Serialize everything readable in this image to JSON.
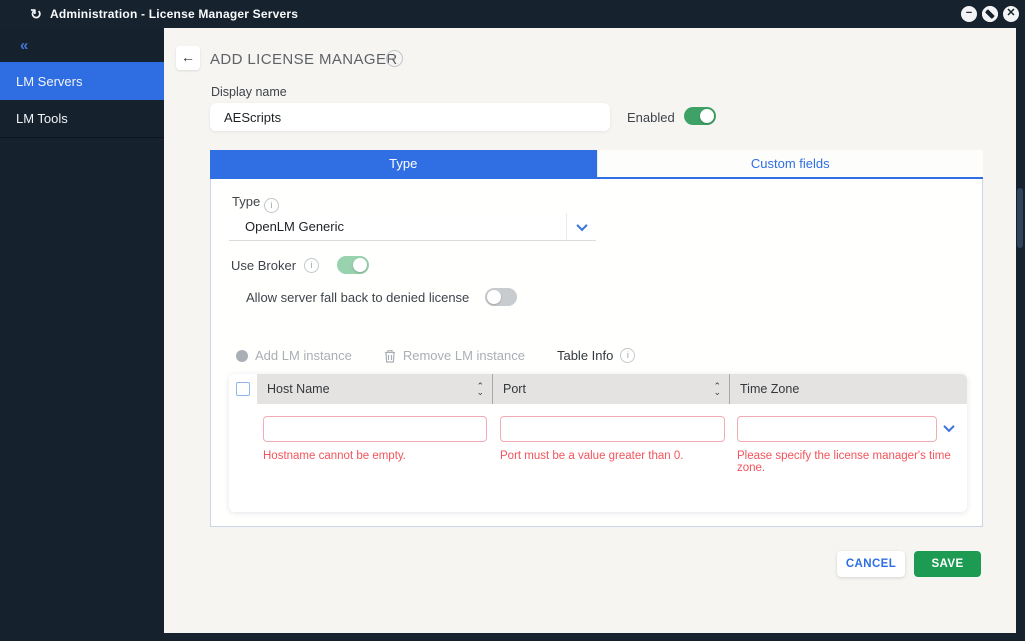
{
  "window": {
    "title": "Administration - License Manager Servers",
    "logo_glyph": "↻"
  },
  "sidebar": {
    "collapse_icon": "«",
    "items": [
      {
        "label": "LM Servers",
        "active": true
      },
      {
        "label": "LM Tools",
        "active": false
      }
    ]
  },
  "header": {
    "back_icon": "←",
    "title": "ADD LICENSE MANAGER",
    "info_icon": "i"
  },
  "form": {
    "display_name": {
      "label": "Display name",
      "value": "AEScripts"
    },
    "enabled": {
      "label": "Enabled",
      "state": "on"
    },
    "tabs": [
      {
        "label": "Type",
        "active": true
      },
      {
        "label": "Custom fields",
        "active": false
      }
    ],
    "type_field": {
      "label": "Type",
      "value": "OpenLM Generic"
    },
    "use_broker": {
      "label": "Use Broker",
      "state": "on"
    },
    "fallback": {
      "label": "Allow server fall back to denied license",
      "state": "off"
    },
    "toolbar": {
      "add_label": "Add LM instance",
      "remove_label": "Remove LM instance",
      "table_info_label": "Table Info"
    },
    "table": {
      "columns": [
        {
          "label": "Host Name",
          "sortable": true
        },
        {
          "label": "Port",
          "sortable": true
        },
        {
          "label": "Time Zone",
          "sortable": false
        }
      ],
      "row_errors": [
        "Hostname cannot be empty.",
        "Port must be a value greater than 0.",
        "Please specify the license manager's time zone."
      ]
    },
    "actions": {
      "cancel": "CANCEL",
      "save": "SAVE"
    }
  },
  "colors": {
    "accent_blue": "#2F6FE3",
    "title_bar": "#16222E",
    "sidebar": "#15212D",
    "background": "#F7F5F1",
    "toggle_green": "#3EA266",
    "toggle_soft_green": "#99D2AE",
    "toggle_off_gray": "#C9CCCE",
    "save_green": "#1E9B53",
    "error_red": "#F2545C",
    "error_border": "#F3ACB5",
    "table_header_gray": "#E4E3E2"
  }
}
